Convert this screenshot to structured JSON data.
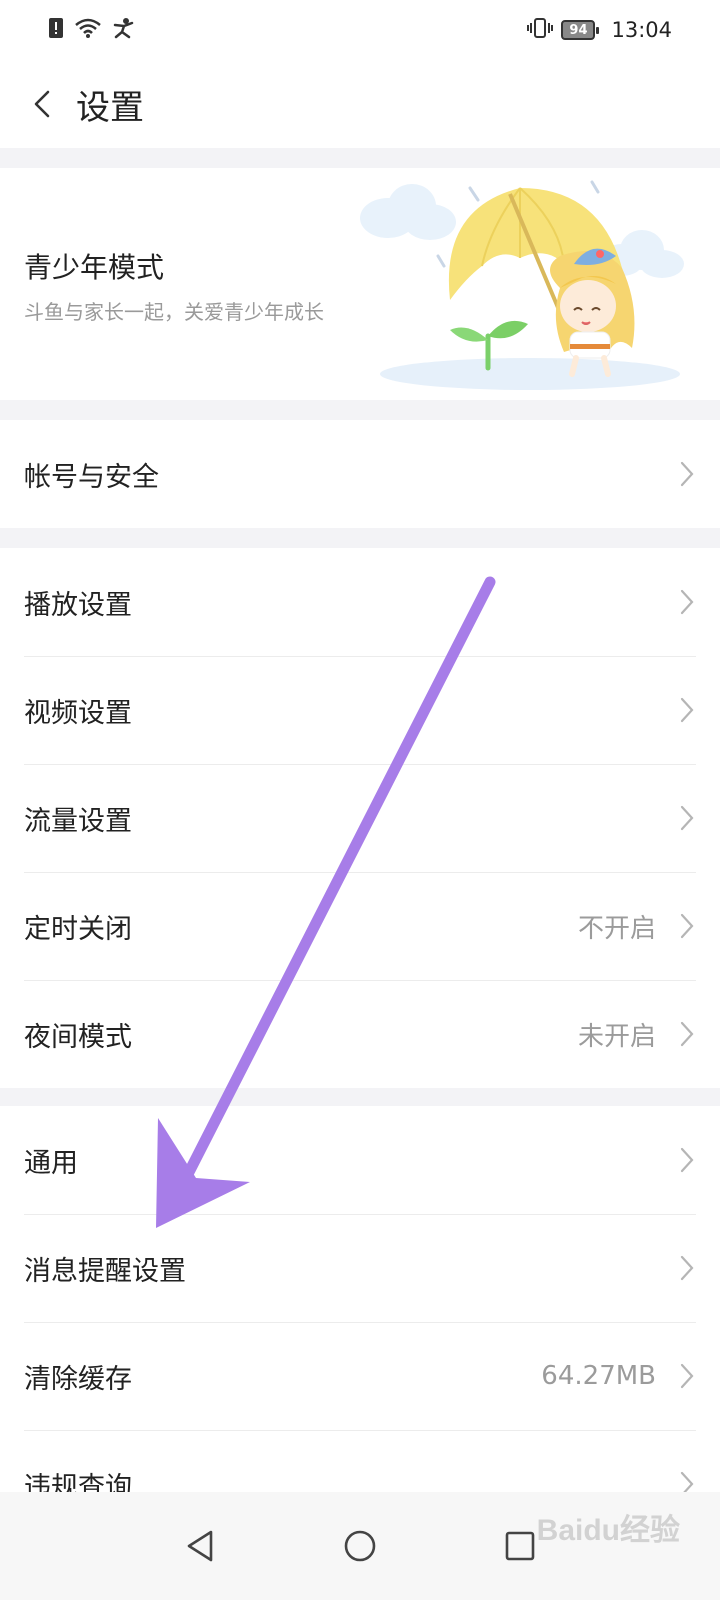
{
  "status_bar": {
    "time": "13:04",
    "battery": "94",
    "icons": [
      "alert-icon",
      "wifi-icon",
      "person-icon",
      "vibrate-icon",
      "battery-icon"
    ]
  },
  "header": {
    "title": "设置",
    "back_icon": "back-chevron-icon"
  },
  "teen_mode": {
    "title": "青少年模式",
    "subtitle": "斗鱼与家长一起，关爱青少年成长"
  },
  "groups": [
    {
      "items": [
        {
          "label": "帐号与安全",
          "value": ""
        }
      ]
    },
    {
      "items": [
        {
          "label": "播放设置",
          "value": ""
        },
        {
          "label": "视频设置",
          "value": ""
        },
        {
          "label": "流量设置",
          "value": ""
        },
        {
          "label": "定时关闭",
          "value": "不开启"
        },
        {
          "label": "夜间模式",
          "value": "未开启"
        }
      ]
    },
    {
      "items": [
        {
          "label": "通用",
          "value": ""
        },
        {
          "label": "消息提醒设置",
          "value": ""
        },
        {
          "label": "清除缓存",
          "value": "64.27MB"
        },
        {
          "label": "违规查询",
          "value": ""
        }
      ]
    }
  ],
  "nav_bar": {
    "buttons": [
      "back-triangle-icon",
      "home-circle-icon",
      "recents-square-icon"
    ]
  },
  "watermark": "Baidu经验",
  "colors": {
    "annotation_arrow": "#a77de8",
    "secondary_text": "#9b9b9b",
    "background": "#f3f3f6"
  }
}
